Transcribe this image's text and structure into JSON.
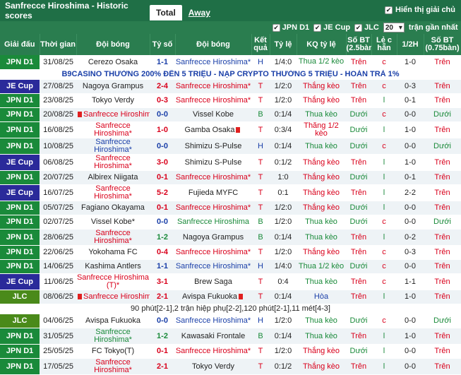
{
  "header": {
    "title": "Sanfrecce Hiroshima - Historic scores",
    "tabs": [
      {
        "label": "Total"
      },
      {
        "label": "Away"
      }
    ],
    "option_label": "Hiển thị giải chủ"
  },
  "filters": {
    "jpn": "JPN D1",
    "jec": "JE Cup",
    "jlc": "JLC",
    "select_value": "20",
    "suffix": "trận gần nhất"
  },
  "columns": {
    "league": "Giải đấu",
    "time": "Thời gian",
    "home": "Đội bóng",
    "score": "Tỷ số",
    "away": "Đội bóng",
    "result": "Kết quả",
    "odds": "Tỷ lệ",
    "odds_result": "KQ tỷ lệ",
    "goals": "Số BT (2.5bàn)",
    "oe": "Lẻ c hẵn",
    "half": "1/2H",
    "goals2": "Số BT (0.75bàn)"
  },
  "banner": "B9CASINO THƯỞNG 200% ĐẾN 5 TRIỆU - NẠP CRYPTO THƯỞNG 5 TRIỆU - HOÀN TRẢ 1%",
  "note": "90 phút[2-1],2 trận hiệp phụ[2-2],120 phút[2-1],11 mét[4-3]",
  "colors": {
    "jpn": "#1a8a3a",
    "jec": "#2a2a9a",
    "jlc": "#4a8a1a"
  },
  "rows": [
    {
      "league": "JPN D1",
      "lc": "jpn",
      "date": "31/08/25",
      "home": "Cerezo Osaka",
      "hc": "",
      "score": "1-1",
      "sc": "blue",
      "away": "Sanfrecce Hiroshima*",
      "ac": "blue",
      "res": "H",
      "rc": "blue",
      "odds": "1/4:0",
      "kq": "Thua 1/2 kèo",
      "kc": "green",
      "g": "Trên",
      "gc": "red",
      "oe": "c",
      "oc": "red",
      "h": "1-0",
      "g2": "Trên",
      "g2c": "red"
    },
    {
      "league": "JE Cup",
      "lc": "jec",
      "date": "27/08/25",
      "home": "Nagoya Grampus",
      "hc": "",
      "score": "2-4",
      "sc": "red",
      "away": "Sanfrecce Hiroshima*",
      "ac": "red",
      "res": "T",
      "rc": "red",
      "odds": "1/2:0",
      "kq": "Thắng kèo",
      "kc": "red",
      "g": "Trên",
      "gc": "red",
      "oe": "c",
      "oc": "red",
      "h": "0-3",
      "g2": "Trên",
      "g2c": "red"
    },
    {
      "league": "JPN D1",
      "lc": "jpn",
      "date": "23/08/25",
      "home": "Tokyo Verdy",
      "hc": "",
      "score": "0-3",
      "sc": "red",
      "away": "Sanfrecce Hiroshima*",
      "ac": "red",
      "res": "T",
      "rc": "red",
      "odds": "1/2:0",
      "kq": "Thắng kèo",
      "kc": "red",
      "g": "Trên",
      "gc": "red",
      "oe": "l",
      "oc": "green",
      "h": "0-1",
      "g2": "Trên",
      "g2c": "red"
    },
    {
      "league": "JPN D1",
      "lc": "jpn",
      "date": "20/08/25",
      "home": "Sanfrecce Hiroshima",
      "hc": "red",
      "hcard": "red",
      "score": "0-0",
      "sc": "blue",
      "away": "Vissel Kobe",
      "ac": "",
      "res": "B",
      "rc": "green",
      "odds": "0:1/4",
      "kq": "Thua kèo",
      "kc": "green",
      "g": "Dưới",
      "gc": "green",
      "oe": "c",
      "oc": "red",
      "h": "0-0",
      "g2": "Dưới",
      "g2c": "green"
    },
    {
      "league": "JPN D1",
      "lc": "jpn",
      "date": "16/08/25",
      "home": "Sanfrecce Hiroshima*",
      "hc": "red",
      "score": "1-0",
      "sc": "red",
      "away": "Gamba Osaka",
      "ac": "",
      "acard": "red",
      "res": "T",
      "rc": "red",
      "odds": "0:3/4",
      "kq": "Thắng 1/2 kèo",
      "kc": "red",
      "g": "Dưới",
      "gc": "green",
      "oe": "l",
      "oc": "green",
      "h": "1-0",
      "g2": "Trên",
      "g2c": "red"
    },
    {
      "league": "JPN D1",
      "lc": "jpn",
      "date": "10/08/25",
      "home": "Sanfrecce Hiroshima*",
      "hc": "blue",
      "score": "0-0",
      "sc": "blue",
      "away": "Shimizu S-Pulse",
      "ac": "",
      "res": "H",
      "rc": "blue",
      "odds": "0:1/4",
      "kq": "Thua kèo",
      "kc": "green",
      "g": "Dưới",
      "gc": "green",
      "oe": "c",
      "oc": "red",
      "h": "0-0",
      "g2": "Dưới",
      "g2c": "green"
    },
    {
      "league": "JE Cup",
      "lc": "jec",
      "date": "06/08/25",
      "home": "Sanfrecce Hiroshima*",
      "hc": "red",
      "score": "3-0",
      "sc": "red",
      "away": "Shimizu S-Pulse",
      "ac": "",
      "res": "T",
      "rc": "red",
      "odds": "0:1/2",
      "kq": "Thắng kèo",
      "kc": "red",
      "g": "Trên",
      "gc": "red",
      "oe": "l",
      "oc": "green",
      "h": "1-0",
      "g2": "Trên",
      "g2c": "red"
    },
    {
      "league": "JPN D1",
      "lc": "jpn",
      "date": "20/07/25",
      "home": "Albirex Niigata",
      "hc": "",
      "score": "0-1",
      "sc": "red",
      "away": "Sanfrecce Hiroshima*",
      "ac": "red",
      "res": "T",
      "rc": "red",
      "odds": "1:0",
      "kq": "Thắng kèo",
      "kc": "red",
      "g": "Dưới",
      "gc": "green",
      "oe": "l",
      "oc": "green",
      "h": "0-1",
      "g2": "Trên",
      "g2c": "red"
    },
    {
      "league": "JE Cup",
      "lc": "jec",
      "date": "16/07/25",
      "home": "Sanfrecce Hiroshima*",
      "hc": "red",
      "score": "5-2",
      "sc": "red",
      "away": "Fujieda MYFC",
      "ac": "",
      "res": "T",
      "rc": "red",
      "odds": "0:1",
      "kq": "Thắng kèo",
      "kc": "red",
      "g": "Trên",
      "gc": "red",
      "oe": "l",
      "oc": "green",
      "h": "2-2",
      "g2": "Trên",
      "g2c": "red"
    },
    {
      "league": "JPN D1",
      "lc": "jpn",
      "date": "05/07/25",
      "home": "Fagiano Okayama",
      "hc": "",
      "score": "0-1",
      "sc": "red",
      "away": "Sanfrecce Hiroshima*",
      "ac": "red",
      "res": "T",
      "rc": "red",
      "odds": "1/2:0",
      "kq": "Thắng kèo",
      "kc": "red",
      "g": "Dưới",
      "gc": "green",
      "oe": "l",
      "oc": "green",
      "h": "0-0",
      "g2": "Trên",
      "g2c": "red"
    },
    {
      "league": "JPN D1",
      "lc": "jpn",
      "date": "02/07/25",
      "home": "Vissel Kobe*",
      "hc": "",
      "score": "0-0",
      "sc": "blue",
      "away": "Sanfrecce Hiroshima",
      "ac": "green",
      "res": "B",
      "rc": "green",
      "odds": "1/2:0",
      "kq": "Thua kèo",
      "kc": "green",
      "g": "Dưới",
      "gc": "green",
      "oe": "c",
      "oc": "red",
      "h": "0-0",
      "g2": "Dưới",
      "g2c": "green"
    },
    {
      "league": "JPN D1",
      "lc": "jpn",
      "date": "28/06/25",
      "home": "Sanfrecce Hiroshima*",
      "hc": "red",
      "score": "1-2",
      "sc": "green",
      "away": "Nagoya Grampus",
      "ac": "",
      "res": "B",
      "rc": "green",
      "odds": "0:1/4",
      "kq": "Thua kèo",
      "kc": "green",
      "g": "Trên",
      "gc": "red",
      "oe": "l",
      "oc": "green",
      "h": "0-2",
      "g2": "Trên",
      "g2c": "red"
    },
    {
      "league": "JPN D1",
      "lc": "jpn",
      "date": "22/06/25",
      "home": "Yokohama FC",
      "hc": "",
      "score": "0-4",
      "sc": "red",
      "away": "Sanfrecce Hiroshima*",
      "ac": "red",
      "res": "T",
      "rc": "red",
      "odds": "1/2:0",
      "kq": "Thắng kèo",
      "kc": "red",
      "g": "Trên",
      "gc": "red",
      "oe": "c",
      "oc": "red",
      "h": "0-3",
      "g2": "Trên",
      "g2c": "red"
    },
    {
      "league": "JPN D1",
      "lc": "jpn",
      "date": "14/06/25",
      "home": "Kashima Antlers",
      "hc": "",
      "score": "1-1",
      "sc": "blue",
      "away": "Sanfrecce Hiroshima*",
      "ac": "blue",
      "res": "H",
      "rc": "blue",
      "odds": "1/4:0",
      "kq": "Thua 1/2 kèo",
      "kc": "green",
      "g": "Dưới",
      "gc": "green",
      "oe": "c",
      "oc": "red",
      "h": "0-0",
      "g2": "Trên",
      "g2c": "red"
    },
    {
      "league": "JE Cup",
      "lc": "jec",
      "date": "11/06/25",
      "home": "Sanfrecce Hiroshima (T)*",
      "hc": "red",
      "score": "3-1",
      "sc": "red",
      "away": "Brew Saga",
      "ac": "",
      "res": "T",
      "rc": "red",
      "odds": "0:4",
      "kq": "Thua kèo",
      "kc": "green",
      "g": "Trên",
      "gc": "red",
      "oe": "c",
      "oc": "red",
      "h": "1-1",
      "g2": "Trên",
      "g2c": "red"
    },
    {
      "league": "JLC",
      "lc": "jlc",
      "date": "08/06/25",
      "home": "Sanfrecce Hiroshima",
      "hc": "red",
      "hcard": "red",
      "score": "2-1",
      "sc": "red",
      "away": "Avispa Fukuoka",
      "ac": "",
      "acard": "red",
      "res": "T",
      "rc": "red",
      "odds": "0:1/4",
      "kq": "Hòa",
      "kc": "blue",
      "g": "Trên",
      "gc": "red",
      "oe": "l",
      "oc": "green",
      "h": "1-0",
      "g2": "Trên",
      "g2c": "red"
    },
    {
      "league": "JLC",
      "lc": "jlc",
      "date": "04/06/25",
      "home": "Avispa Fukuoka",
      "hc": "",
      "score": "0-0",
      "sc": "blue",
      "away": "Sanfrecce Hiroshima*",
      "ac": "blue",
      "res": "H",
      "rc": "blue",
      "odds": "1/2:0",
      "kq": "Thua kèo",
      "kc": "green",
      "g": "Dưới",
      "gc": "green",
      "oe": "c",
      "oc": "red",
      "h": "0-0",
      "g2": "Dưới",
      "g2c": "green"
    },
    {
      "league": "JPN D1",
      "lc": "jpn",
      "date": "31/05/25",
      "home": "Sanfrecce Hiroshima*",
      "hc": "green",
      "score": "1-2",
      "sc": "green",
      "away": "Kawasaki Frontale",
      "ac": "",
      "res": "B",
      "rc": "green",
      "odds": "0:1/4",
      "kq": "Thua kèo",
      "kc": "green",
      "g": "Trên",
      "gc": "red",
      "oe": "l",
      "oc": "green",
      "h": "1-0",
      "g2": "Trên",
      "g2c": "red"
    },
    {
      "league": "JPN D1",
      "lc": "jpn",
      "date": "25/05/25",
      "home": "FC Tokyo(T)",
      "hc": "",
      "score": "0-1",
      "sc": "red",
      "away": "Sanfrecce Hiroshima*",
      "ac": "red",
      "res": "T",
      "rc": "red",
      "odds": "1/2:0",
      "kq": "Thắng kèo",
      "kc": "red",
      "g": "Dưới",
      "gc": "green",
      "oe": "l",
      "oc": "green",
      "h": "0-0",
      "g2": "Trên",
      "g2c": "red"
    },
    {
      "league": "JPN D1",
      "lc": "jpn",
      "date": "17/05/25",
      "home": "Sanfrecce Hiroshima*",
      "hc": "red",
      "score": "2-1",
      "sc": "red",
      "away": "Tokyo Verdy",
      "ac": "",
      "res": "T",
      "rc": "red",
      "odds": "0:1/2",
      "kq": "Thắng kèo",
      "kc": "red",
      "g": "Trên",
      "gc": "red",
      "oe": "l",
      "oc": "green",
      "h": "0-0",
      "g2": "Trên",
      "g2c": "red"
    }
  ]
}
